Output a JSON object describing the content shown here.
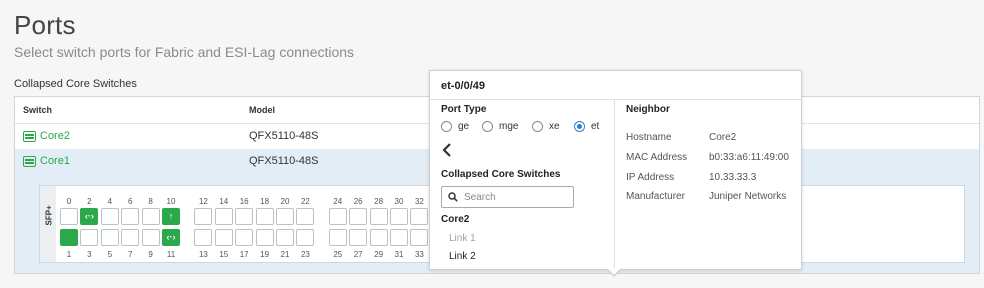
{
  "page": {
    "title": "Ports",
    "subtitle": "Select switch ports for Fabric and ESI-Lag connections",
    "section_label": "Collapsed Core Switches"
  },
  "table": {
    "columns": {
      "switch": "Switch",
      "model": "Model"
    },
    "rows": [
      {
        "name": "Core2",
        "model": "QFX5110-48S",
        "selected": false
      },
      {
        "name": "Core1",
        "model": "QFX5110-48S",
        "selected": true
      }
    ]
  },
  "port_panel": {
    "sfp_label": "SFP+",
    "top_numbers": [
      "0",
      "2",
      "4",
      "6",
      "8",
      "10",
      "12",
      "14",
      "16",
      "18",
      "20",
      "22",
      "24",
      "26",
      "28",
      "30",
      "32"
    ],
    "bottom_numbers": [
      "1",
      "3",
      "5",
      "7",
      "9",
      "11",
      "13",
      "15",
      "17",
      "19",
      "21",
      "23",
      "25",
      "27",
      "29",
      "31",
      "33"
    ],
    "active_ports": [
      {
        "port": "2",
        "icon": "link-icon"
      },
      {
        "port": "10",
        "icon": "uplink-arrow-icon"
      },
      {
        "port": "1",
        "icon": ""
      },
      {
        "port": "11",
        "icon": "link-icon"
      }
    ],
    "accent": "#2aa84a"
  },
  "popup": {
    "title": "et-0/0/49",
    "port_type_label": "Port Type",
    "port_types": [
      {
        "label": "ge",
        "checked": false
      },
      {
        "label": "mge",
        "checked": false
      },
      {
        "label": "xe",
        "checked": false
      },
      {
        "label": "et",
        "checked": true
      }
    ],
    "collapsed_label": "Collapsed Core Switches",
    "search_placeholder": "Search",
    "search_value": "",
    "group_label": "Core2",
    "links": [
      {
        "label": "Link 1",
        "enabled": false
      },
      {
        "label": "Link 2",
        "enabled": true
      }
    ],
    "neighbor": {
      "heading": "Neighbor",
      "fields": [
        {
          "key": "Hostname",
          "value": "Core2"
        },
        {
          "key": "MAC Address",
          "value": "b0:33:a6:11:49:00"
        },
        {
          "key": "IP Address",
          "value": "10.33.33.3"
        },
        {
          "key": "Manufacturer",
          "value": "Juniper Networks"
        }
      ]
    },
    "radio_accent": "#2b7bd0"
  }
}
